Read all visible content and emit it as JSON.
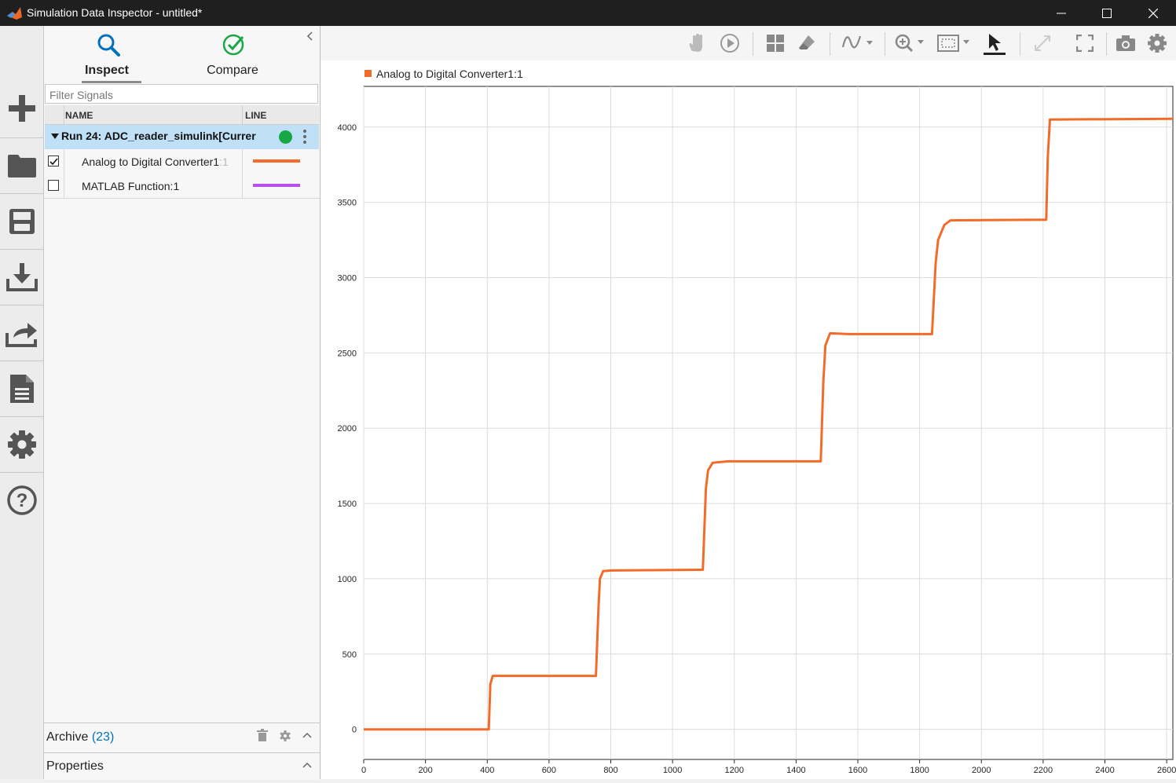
{
  "window": {
    "title": "Simulation Data Inspector - untitled*"
  },
  "tabs": {
    "inspect": "Inspect",
    "compare": "Compare"
  },
  "filter": {
    "placeholder": "Filter Signals"
  },
  "table": {
    "headers": {
      "name": "NAME",
      "line": "LINE"
    },
    "run": {
      "label": "Run 24: ADC_reader_simulink[Currer",
      "status_color": "#17a745"
    },
    "signals": [
      {
        "name": "Analog to Digital Converter1",
        "suffix": ":1",
        "checked": true,
        "color": "#f26b29"
      },
      {
        "name": "MATLAB Function:1",
        "checked": false,
        "color": "#b64ef0"
      }
    ]
  },
  "archive": {
    "label": "Archive",
    "count": "(23)"
  },
  "properties": {
    "label": "Properties"
  },
  "colors": {
    "accent": "#0072bd",
    "compare": "#17a745",
    "signal": "#f26b29"
  },
  "chart_data": {
    "type": "line",
    "legend": [
      "Analog to Digital Converter1:1"
    ],
    "legend_placement": "top-left",
    "grid": true,
    "xlim": [
      0,
      2620
    ],
    "ylim": [
      -200,
      4270
    ],
    "xticks": [
      0,
      200,
      400,
      600,
      800,
      1000,
      1200,
      1400,
      1600,
      1800,
      2000,
      2200,
      2400,
      2600
    ],
    "yticks": [
      0,
      500,
      1000,
      1500,
      2000,
      2500,
      3000,
      3500,
      4000
    ],
    "series": [
      {
        "name": "Analog to Digital Converter1:1",
        "color": "#f26b29",
        "x": [
          0,
          405,
          410,
          418,
          752,
          760,
          765,
          775,
          800,
          1098,
          1108,
          1115,
          1130,
          1180,
          1480,
          1488,
          1495,
          1510,
          1570,
          1840,
          1852,
          1860,
          1880,
          1900,
          2210,
          2215,
          2222,
          2620
        ],
        "y": [
          0,
          0,
          300,
          355,
          355,
          800,
          1000,
          1050,
          1055,
          1060,
          1600,
          1720,
          1770,
          1780,
          1780,
          2300,
          2550,
          2630,
          2625,
          2625,
          3100,
          3250,
          3350,
          3380,
          3385,
          3800,
          4050,
          4055
        ]
      }
    ]
  }
}
